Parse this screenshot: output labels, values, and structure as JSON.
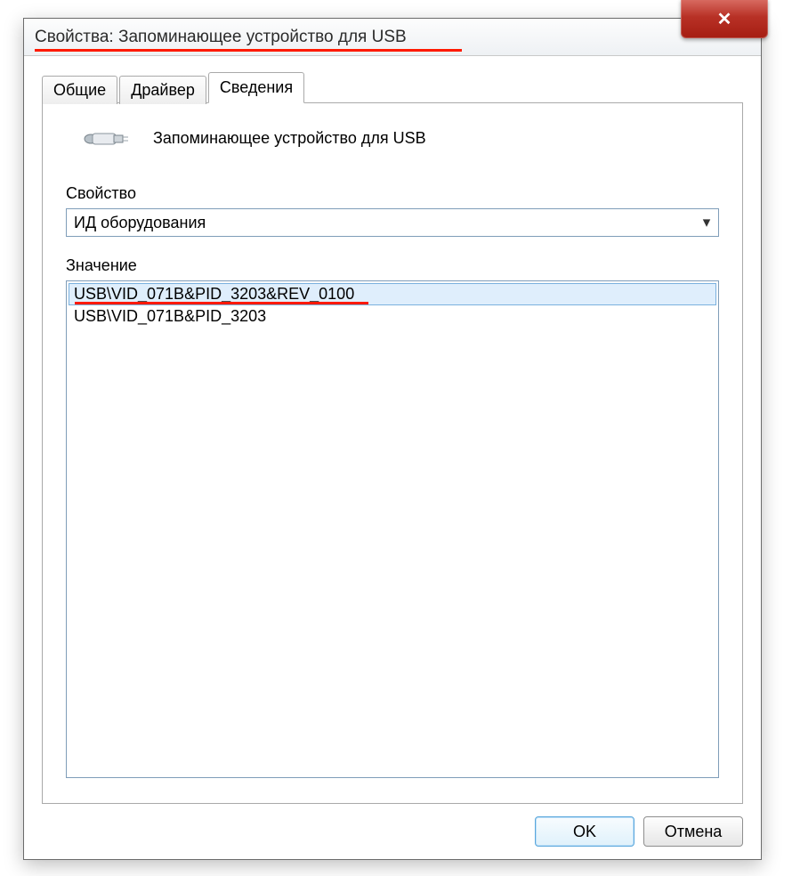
{
  "window": {
    "title": "Свойства: Запоминающее устройство для USB"
  },
  "tabs": [
    {
      "label": "Общие",
      "active": false
    },
    {
      "label": "Драйвер",
      "active": false
    },
    {
      "label": "Сведения",
      "active": true
    }
  ],
  "device": {
    "name": "Запоминающее устройство для USB"
  },
  "property": {
    "label": "Свойство",
    "selected": "ИД оборудования"
  },
  "value": {
    "label": "Значение",
    "items": [
      "USB\\VID_071B&PID_3203&REV_0100",
      "USB\\VID_071B&PID_3203"
    ],
    "selected_index": 0
  },
  "buttons": {
    "ok": "OK",
    "cancel": "Отмена"
  }
}
